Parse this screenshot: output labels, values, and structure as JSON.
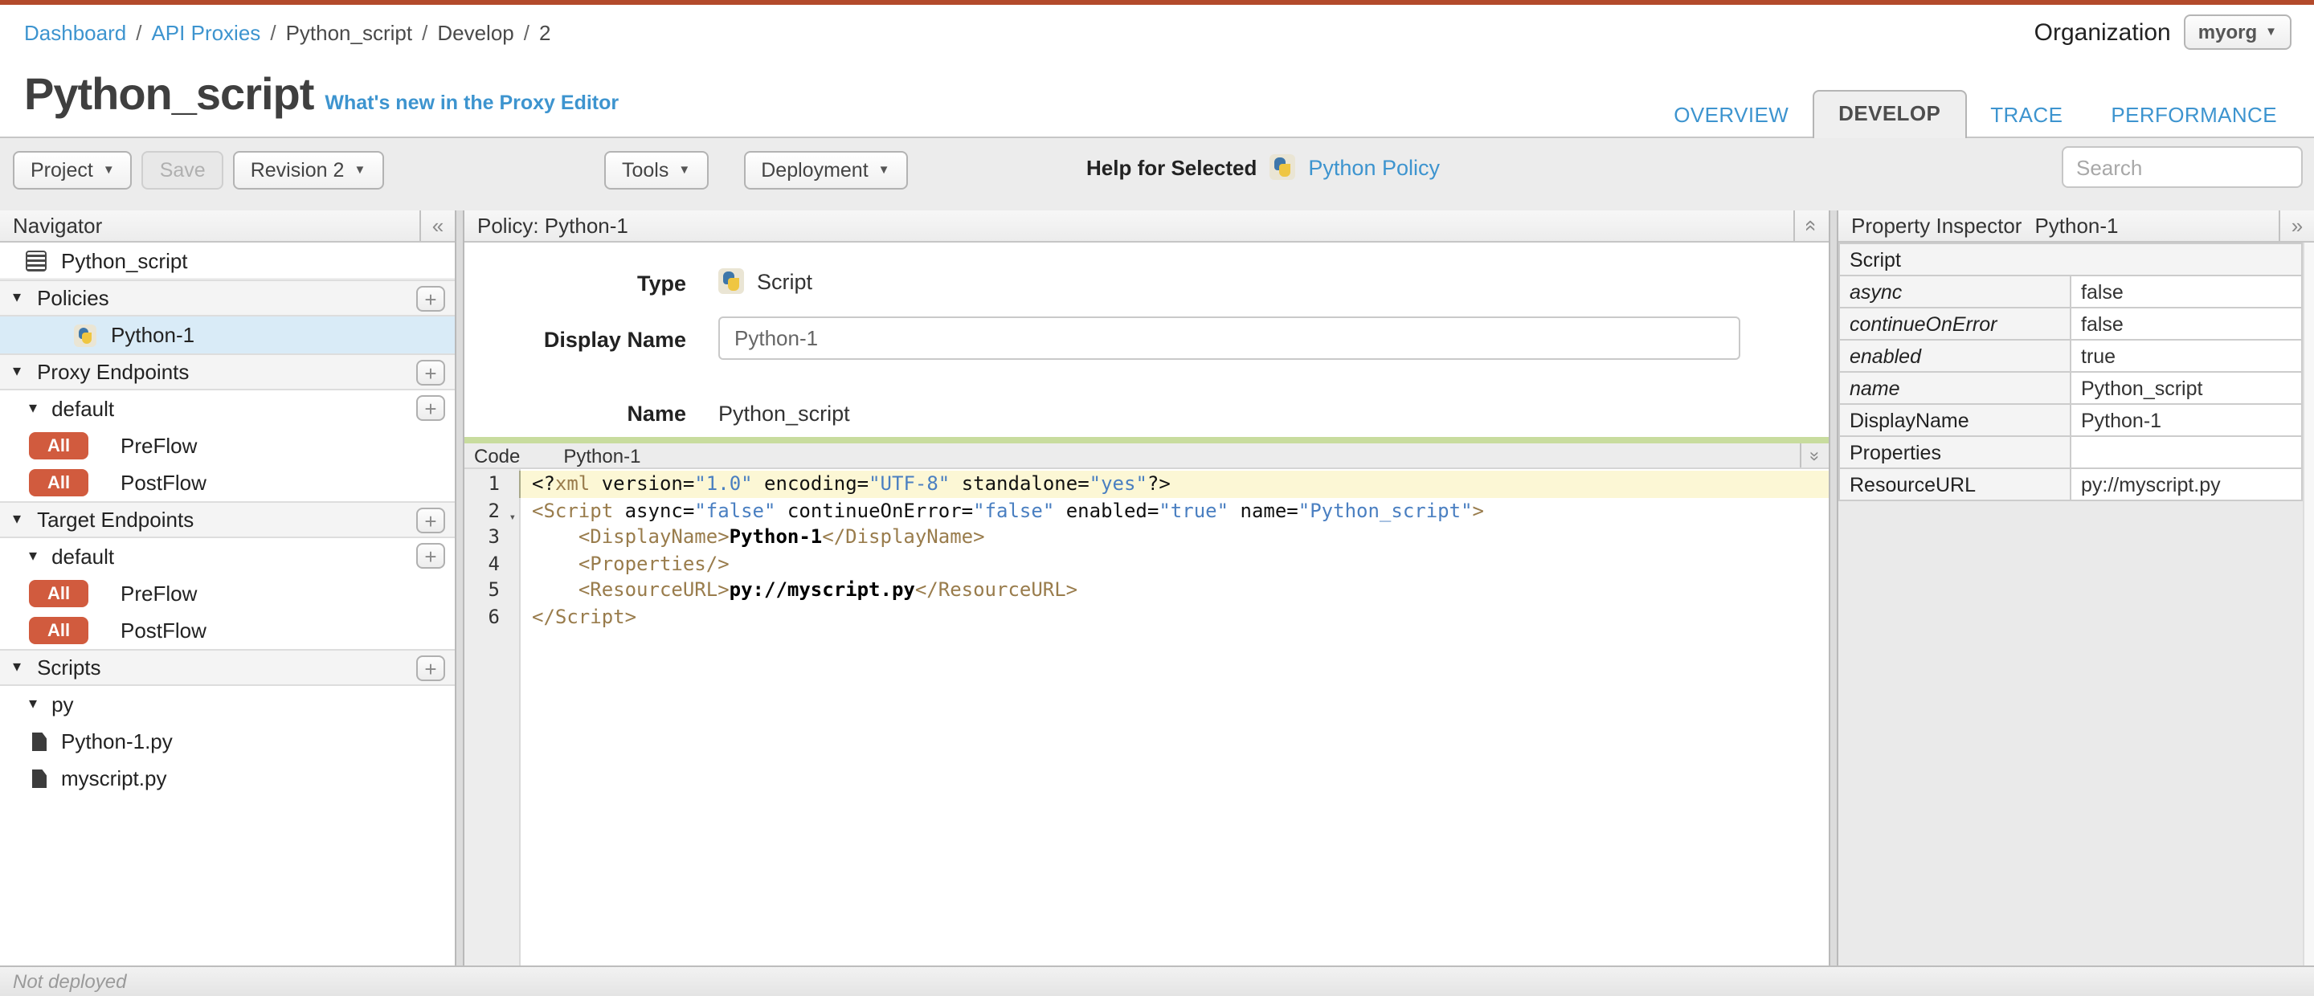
{
  "chrome": {
    "breadcrumb": [
      {
        "label": "Dashboard",
        "link": true
      },
      {
        "label": "API Proxies",
        "link": true
      },
      {
        "label": "Python_script",
        "link": false
      },
      {
        "label": "Develop",
        "link": false
      },
      {
        "label": "2",
        "link": false
      }
    ],
    "organization_label": "Organization",
    "organization_value": "myorg",
    "title": "Python_script",
    "whats_new": "What's new in the Proxy Editor",
    "tabs": [
      {
        "label": "OVERVIEW",
        "active": false
      },
      {
        "label": "DEVELOP",
        "active": true
      },
      {
        "label": "TRACE",
        "active": false
      },
      {
        "label": "PERFORMANCE",
        "active": false
      }
    ]
  },
  "toolbar": {
    "project_label": "Project",
    "save_label": "Save",
    "revision_label": "Revision 2",
    "tools_label": "Tools",
    "deployment_label": "Deployment",
    "help_label": "Help for Selected",
    "help_link": "Python Policy",
    "search_placeholder": "Search"
  },
  "navigator": {
    "header": "Navigator",
    "collapse_icon": "«",
    "tree": [
      {
        "type": "root",
        "icon": "proxy-doc",
        "label": "Python_script"
      },
      {
        "type": "section",
        "label": "Policies",
        "plus": true
      },
      {
        "type": "policy",
        "icon": "python",
        "label": "Python-1",
        "selected": true
      },
      {
        "type": "section",
        "label": "Proxy Endpoints",
        "plus": true
      },
      {
        "type": "sub",
        "label": "default",
        "plus": true
      },
      {
        "type": "flow",
        "badge": "All",
        "label": "PreFlow"
      },
      {
        "type": "flow",
        "badge": "All",
        "label": "PostFlow"
      },
      {
        "type": "section",
        "label": "Target Endpoints",
        "plus": true
      },
      {
        "type": "sub",
        "label": "default",
        "plus": true
      },
      {
        "type": "flow",
        "badge": "All",
        "label": "PreFlow"
      },
      {
        "type": "flow",
        "badge": "All",
        "label": "PostFlow"
      },
      {
        "type": "section",
        "label": "Scripts",
        "plus": true
      },
      {
        "type": "sub",
        "label": "py",
        "plus": false
      },
      {
        "type": "file",
        "label": "Python-1.py"
      },
      {
        "type": "file",
        "label": "myscript.py"
      }
    ]
  },
  "policy": {
    "header": "Policy: Python-1",
    "type_label": "Type",
    "type_value": "Script",
    "display_name_label": "Display Name",
    "display_name_value": "Python-1",
    "name_label": "Name",
    "name_value": "Python_script"
  },
  "code": {
    "header_label": "Code",
    "header_value": "Python-1",
    "lines": [
      {
        "num": 1,
        "active": true,
        "fold": false,
        "tokens": [
          [
            "pi",
            "<?"
          ],
          [
            "tag",
            "xml"
          ],
          [
            "attr",
            " version="
          ],
          [
            "str",
            "\"1.0\""
          ],
          [
            "attr",
            " encoding="
          ],
          [
            "str",
            "\"UTF-8\""
          ],
          [
            "attr",
            " standalone="
          ],
          [
            "str",
            "\"yes\""
          ],
          [
            "pi",
            "?>"
          ]
        ]
      },
      {
        "num": 2,
        "active": false,
        "fold": true,
        "tokens": [
          [
            "tag",
            "<Script"
          ],
          [
            "attr",
            " async="
          ],
          [
            "str",
            "\"false\""
          ],
          [
            "attr",
            " continueOnError="
          ],
          [
            "str",
            "\"false\""
          ],
          [
            "attr",
            " enabled="
          ],
          [
            "str",
            "\"true\""
          ],
          [
            "attr",
            " name="
          ],
          [
            "str",
            "\"Python_script\""
          ],
          [
            "tag",
            ">"
          ]
        ]
      },
      {
        "num": 3,
        "active": false,
        "fold": false,
        "tokens": [
          [
            "sp",
            "    "
          ],
          [
            "tag",
            "<DisplayName>"
          ],
          [
            "txt",
            "Python-1"
          ],
          [
            "tag",
            "</DisplayName>"
          ]
        ]
      },
      {
        "num": 4,
        "active": false,
        "fold": false,
        "tokens": [
          [
            "sp",
            "    "
          ],
          [
            "tag",
            "<Properties/>"
          ]
        ]
      },
      {
        "num": 5,
        "active": false,
        "fold": false,
        "tokens": [
          [
            "sp",
            "    "
          ],
          [
            "tag",
            "<ResourceURL>"
          ],
          [
            "txt",
            "py://myscript.py"
          ],
          [
            "tag",
            "</ResourceURL>"
          ]
        ]
      },
      {
        "num": 6,
        "active": false,
        "fold": false,
        "tokens": [
          [
            "tag",
            "</Script>"
          ]
        ]
      }
    ]
  },
  "inspector": {
    "header": "Property Inspector",
    "header_value": "Python-1",
    "expand_icon": "»",
    "rows": [
      {
        "kind": "section",
        "label": "Script",
        "value": ""
      },
      {
        "kind": "attr",
        "label": "async",
        "value": "false"
      },
      {
        "kind": "attr",
        "label": "continueOnError",
        "value": "false"
      },
      {
        "kind": "attr",
        "label": "enabled",
        "value": "true"
      },
      {
        "kind": "attr",
        "label": "name",
        "value": "Python_script"
      },
      {
        "kind": "elem",
        "label": "DisplayName",
        "value": "Python-1"
      },
      {
        "kind": "elem",
        "label": "Properties",
        "value": ""
      },
      {
        "kind": "elem",
        "label": "ResourceURL",
        "value": "py://myscript.py"
      }
    ]
  },
  "statusbar": {
    "text": "Not deployed"
  }
}
